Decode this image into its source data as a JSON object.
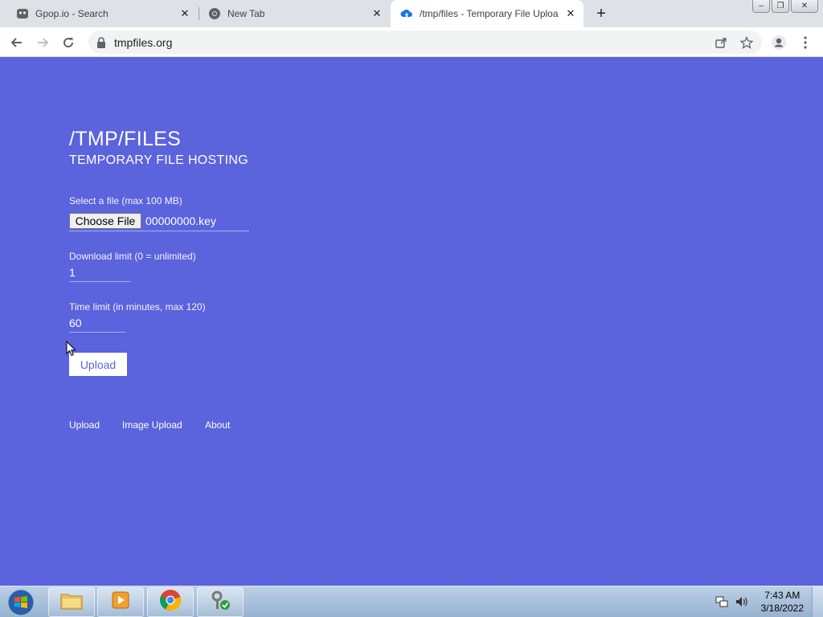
{
  "browser": {
    "tabs": [
      {
        "title": "Gpop.io - Search",
        "icon": "gpop-favicon"
      },
      {
        "title": "New Tab",
        "icon": "chrome-favicon"
      },
      {
        "title": "/tmp/files - Temporary File Uploa",
        "icon": "cloud-upload-favicon",
        "active": true
      }
    ],
    "url": "tmpfiles.org"
  },
  "page": {
    "title": "/TMP/FILES",
    "subtitle": "TEMPORARY FILE HOSTING",
    "file_label": "Select a file (max 100 MB)",
    "choose_file_label": "Choose File",
    "file_name": "00000000.key",
    "download_limit_label": "Download limit (0 = unlimited)",
    "download_limit_value": "1",
    "time_limit_label": "Time limit (in minutes, max 120)",
    "time_limit_value": "60",
    "upload_button": "Upload",
    "footer_links": [
      "Upload",
      "Image Upload",
      "About"
    ]
  },
  "taskbar": {
    "time": "7:43 AM",
    "date": "3/18/2022",
    "apps": [
      "file-explorer-icon",
      "media-player-icon",
      "chrome-icon",
      "security-tool-icon"
    ]
  },
  "colors": {
    "page_background": "#5b63dd",
    "tab_strip": "#dee1e6"
  }
}
